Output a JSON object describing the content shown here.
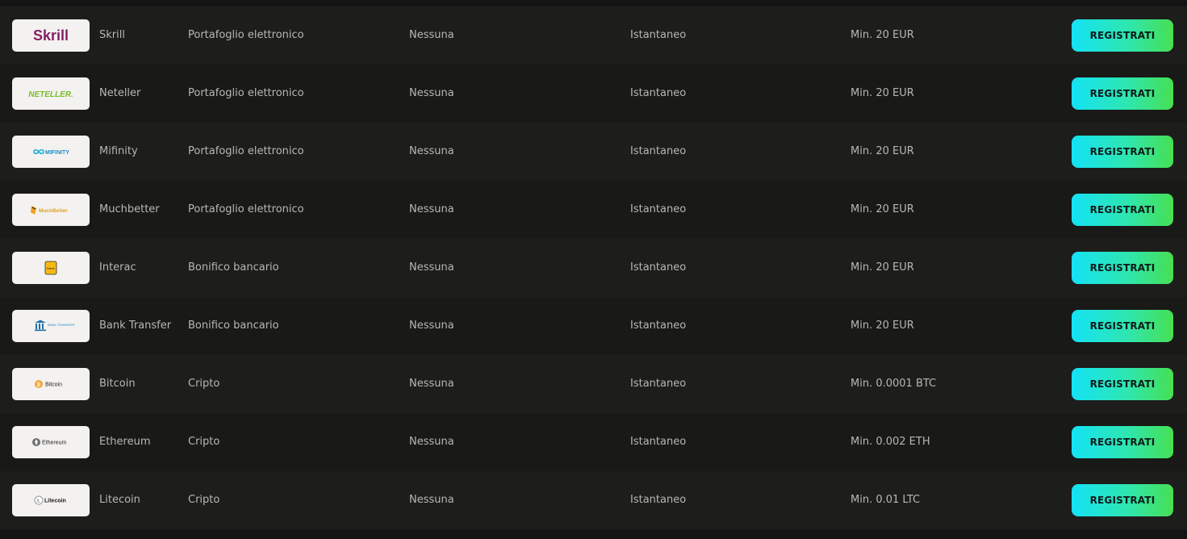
{
  "button_label": "REGISTRATI",
  "colors": {
    "button_gradient_start": "#14e2f5",
    "button_gradient_end": "#47df52",
    "row_bg_odd": "#1d1d1c",
    "row_bg_even": "#191918",
    "text": "#b7b7b3"
  },
  "methods": [
    {
      "name": "Skrill",
      "type": "Portafoglio elettronico",
      "fee": "Nessuna",
      "time": "Istantaneo",
      "min": "Min. 20 EUR",
      "logo_icon": "skrill-logo",
      "logo_text": "Skrill"
    },
    {
      "name": "Neteller",
      "type": "Portafoglio elettronico",
      "fee": "Nessuna",
      "time": "Istantaneo",
      "min": "Min. 20 EUR",
      "logo_icon": "neteller-logo",
      "logo_text": "NETELLER."
    },
    {
      "name": "Mifinity",
      "type": "Portafoglio elettronico",
      "fee": "Nessuna",
      "time": "Istantaneo",
      "min": "Min. 20 EUR",
      "logo_icon": "mifinity-logo",
      "logo_text": "MIFINITY"
    },
    {
      "name": "Muchbetter",
      "type": "Portafoglio elettronico",
      "fee": "Nessuna",
      "time": "Istantaneo",
      "min": "Min. 20 EUR",
      "logo_icon": "muchbetter-logo",
      "logo_text": "MuchBetter"
    },
    {
      "name": "Interac",
      "type": "Bonifico bancario",
      "fee": "Nessuna",
      "time": "Istantaneo",
      "min": "Min. 20 EUR",
      "logo_icon": "interac-logo",
      "logo_text": "Interac"
    },
    {
      "name": "Bank Transfer",
      "type": "Bonifico bancario",
      "fee": "Nessuna",
      "time": "Istantaneo",
      "min": "Min. 20 EUR",
      "logo_icon": "bank-transfer-logo",
      "logo_text": "BANK TRANSFER"
    },
    {
      "name": "Bitcoin",
      "type": "Cripto",
      "fee": "Nessuna",
      "time": "Istantaneo",
      "min": "Min. 0.0001 BTC",
      "logo_icon": "bitcoin-logo",
      "logo_text": "Bitcoin"
    },
    {
      "name": "Ethereum",
      "type": "Cripto",
      "fee": "Nessuna",
      "time": "Istantaneo",
      "min": "Min. 0.002 ETH",
      "logo_icon": "ethereum-logo",
      "logo_text": "Ethereum"
    },
    {
      "name": "Litecoin",
      "type": "Cripto",
      "fee": "Nessuna",
      "time": "Istantaneo",
      "min": "Min. 0.01 LTC",
      "logo_icon": "litecoin-logo",
      "logo_text": "Litecoin"
    }
  ]
}
